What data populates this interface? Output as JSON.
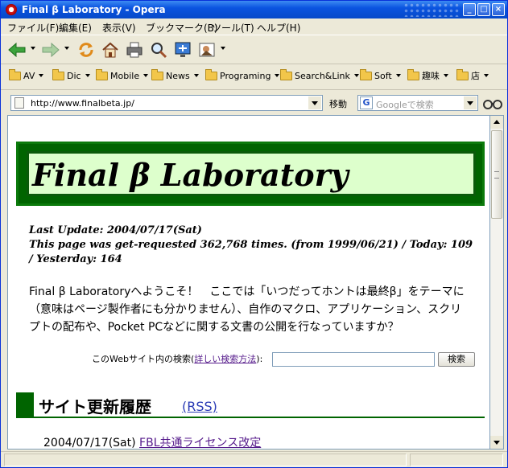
{
  "window": {
    "title": "Final β Laboratory - Opera"
  },
  "menu": [
    "ファイル(F)",
    "編集(E)",
    "表示(V)",
    "ブックマーク(B)",
    "ツール(T)",
    "ヘルプ(H)"
  ],
  "bookmarks": [
    "AV",
    "Dic",
    "Mobile",
    "News",
    "Programing",
    "Search&Link",
    "Soft",
    "趣味",
    "店"
  ],
  "address": {
    "url": "http://www.finalbeta.jp/",
    "go_label": "移動",
    "search_placeholder": "Googleで検索"
  },
  "page": {
    "banner_title": "Final β Laboratory",
    "last_update": "Last Update: 2004/07/17(Sat)",
    "counter": "This page was get-requested 362,768 times. (from 1999/06/21) / Today: 109 / Yesterday: 164",
    "intro": "Final β Laboratoryへようこそ！　ここでは「いつだってホントは最終β」をテーマに（意味はページ製作者にも分かりません）、自作のマクロ、アプリケーション、スクリプトの配布や、Pocket PCなどに関する文書の公開を行なっていますか？",
    "search_label_before": "このWebサイト内の検索(",
    "search_link": "詳しい検索方法",
    "search_label_after": "):",
    "search_button": "検索",
    "section_title": "サイト更新履歴",
    "rss_link": "(RSS)",
    "news": [
      {
        "date": "2004/07/17(Sat)",
        "title": "FBL共通ライセンス改定"
      }
    ]
  }
}
